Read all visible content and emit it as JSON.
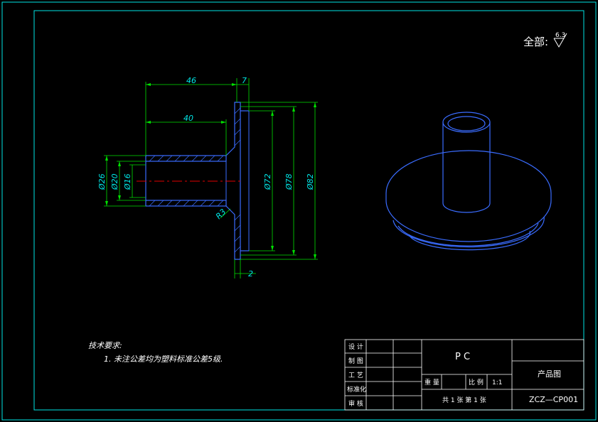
{
  "roughness": {
    "label": "全部:",
    "value": "6.3"
  },
  "dimensions": {
    "len_46": "46",
    "len_40": "40",
    "len_7": "7",
    "len_2": "2",
    "dia_26": "Ø26",
    "dia_20": "Ø20",
    "dia_16": "Ø16",
    "dia_72": "Ø72",
    "dia_78": "Ø78",
    "dia_82": "Ø82",
    "radius": "R3"
  },
  "notes": {
    "title": "技术要求:",
    "line1": "1. 未注公差均为塑料标准公差5级."
  },
  "title_block": {
    "roles": [
      "设 计",
      "制 图",
      "工 艺",
      "标准化",
      "审 核"
    ],
    "material": "P C",
    "weight_label": "重 量",
    "scale_label": "比 例",
    "scale_value": "1:1",
    "sheets": "共 1 张    第 1 张",
    "drawing_name": "产品图",
    "drawing_number": "ZCZ—CP001"
  },
  "colors": {
    "frame": "#00e5e5",
    "part": "#3a6cff",
    "dimension": "#00e000",
    "centerline": "#e00000",
    "text": "#ffffff"
  }
}
